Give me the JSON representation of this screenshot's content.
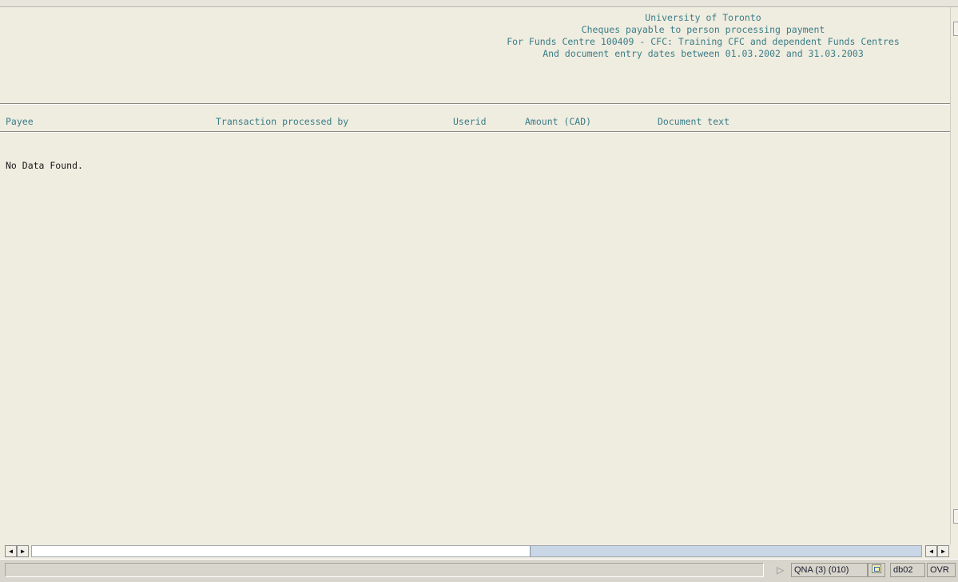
{
  "report": {
    "header": [
      "University of Toronto",
      "Cheques payable to person processing payment",
      "For Funds Centre 100409 - CFC: Training CFC and dependent Funds Centres",
      "And document entry dates between 01.03.2002 and 31.03.2003"
    ],
    "columns": {
      "payee": "Payee",
      "processed_by": "Transaction processed by",
      "userid": "Userid",
      "amount": "Amount (CAD)",
      "doc_text": "Document text"
    },
    "message": "No Data Found."
  },
  "scrollbar": {
    "left_icon": "arrow-left-icon",
    "right_icon": "arrow-right-icon",
    "thumb_fraction": 0.56
  },
  "statusbar": {
    "system": "QNA (3) (010)",
    "server": "db02",
    "mode": "OVR"
  },
  "colors": {
    "background": "#efece0",
    "header_text": "#3a7e86",
    "scroll_track": "#c8d6e6"
  }
}
